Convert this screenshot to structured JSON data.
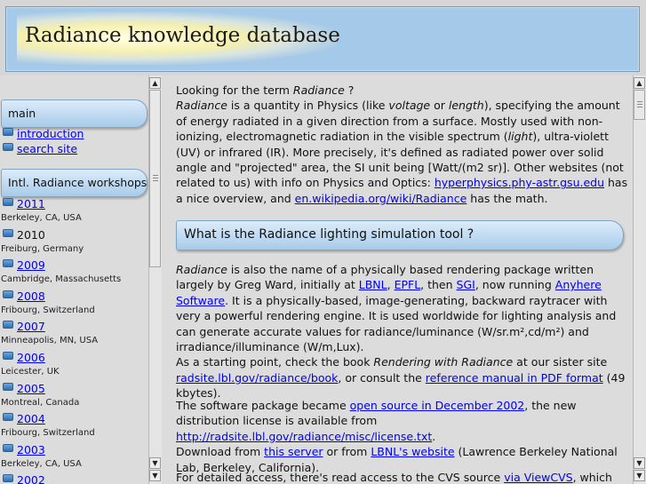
{
  "header": {
    "title": "Radiance knowledge database"
  },
  "sidebar": {
    "main_label": "main",
    "main_items": [
      {
        "label": "introduction"
      },
      {
        "label": "search site"
      }
    ],
    "workshops_label": "Intl. Radiance workshops",
    "workshops": [
      {
        "year": "2011",
        "location": "Berkeley, CA, USA",
        "link": true
      },
      {
        "year": "2010",
        "location": "Freiburg, Germany",
        "link": false
      },
      {
        "year": "2009",
        "location": "Cambridge, Massachusetts",
        "link": true
      },
      {
        "year": "2008",
        "location": "Fribourg, Switzerland",
        "link": true
      },
      {
        "year": "2007",
        "location": "Minneapolis, MN, USA",
        "link": true
      },
      {
        "year": "2006",
        "location": "Leicester, UK",
        "link": true
      },
      {
        "year": "2005",
        "location": "Montreal, Canada",
        "link": true
      },
      {
        "year": "2004",
        "location": "Fribourg, Switzerland",
        "link": true
      },
      {
        "year": "2003",
        "location": "Berkeley, CA, USA",
        "link": true
      },
      {
        "year": "2002",
        "location": "",
        "link": true
      }
    ]
  },
  "main": {
    "intro_question_prefix": "Looking for the term ",
    "intro_question_term": "Radiance",
    "intro_question_suffix": " ?",
    "intro": {
      "t1": "Radiance",
      "t2": " is a quantity in Physics (like ",
      "t3": "voltage",
      "t4": " or ",
      "t5": "length",
      "t6": "), specifying the amount of energy radiated in a given direction from a surface. Mostly used with non-ionizing, electromagnetic radiation in the visible spectrum (",
      "t7": "light",
      "t8": "), ultra-violett (UV) or infrared (IR). More precisely, it's defined as radiated power over solid angle and \"projected\" area, the SI unit being [Watt/(m2 sr)]. Other websites (not related to us) with info on Physics and Optics: ",
      "link1": "hyperphysics.phy-astr.gsu.edu",
      "t9": " has a nice overview, and ",
      "link2": "en.wikipedia.org/wiki/Radiance",
      "t10": " has the math."
    },
    "section_heading": "What is the Radiance lighting simulation tool ?",
    "tool": {
      "t1": "Radiance",
      "t2": " is also the name of a physically based rendering package written largely by Greg Ward, initially at ",
      "lbnl": "LBNL",
      "t3": ", ",
      "epfl": "EPFL",
      "t4": ", then ",
      "sgi": "SGI",
      "t5": ", now running ",
      "anyhere": "Anyhere Software",
      "t6": ". It is a physically-based, image-generating, backward raytracer with very a powerful rendering engine. It is used worldwide for lighting analysis and can generate accurate values for radiance/luminance (W/sr.m²,cd/m²) and irradiance/illuminance (W/m,Lux).",
      "t7": "As a starting point, check the book ",
      "book": "Rendering with Radiance",
      "t8": " at our sister site ",
      "radsite_book": "radsite.lbl.gov/radiance/book",
      "t9": ", or consult the ",
      "ref_manual": "reference manual in PDF format",
      "t10": " (49 kbytes)."
    },
    "software": {
      "t1": "The software package became ",
      "open_source": "open source in December 2002",
      "t2": ", the new distribution license is available from ",
      "license": "http://radsite.lbl.gov/radiance/misc/license.txt",
      "t3": ".",
      "t4": "Download from ",
      "this_server": "this server",
      "t5": " or from ",
      "lbnl_site": "LBNL's website",
      "t6": " (Lawrence Berkeley National Lab, Berkeley, California)."
    },
    "cvs": {
      "t1": "For detailed access, there's read access to the CVS source ",
      "viewcvs": "via ViewCVS",
      "t2": ", which allows"
    }
  }
}
